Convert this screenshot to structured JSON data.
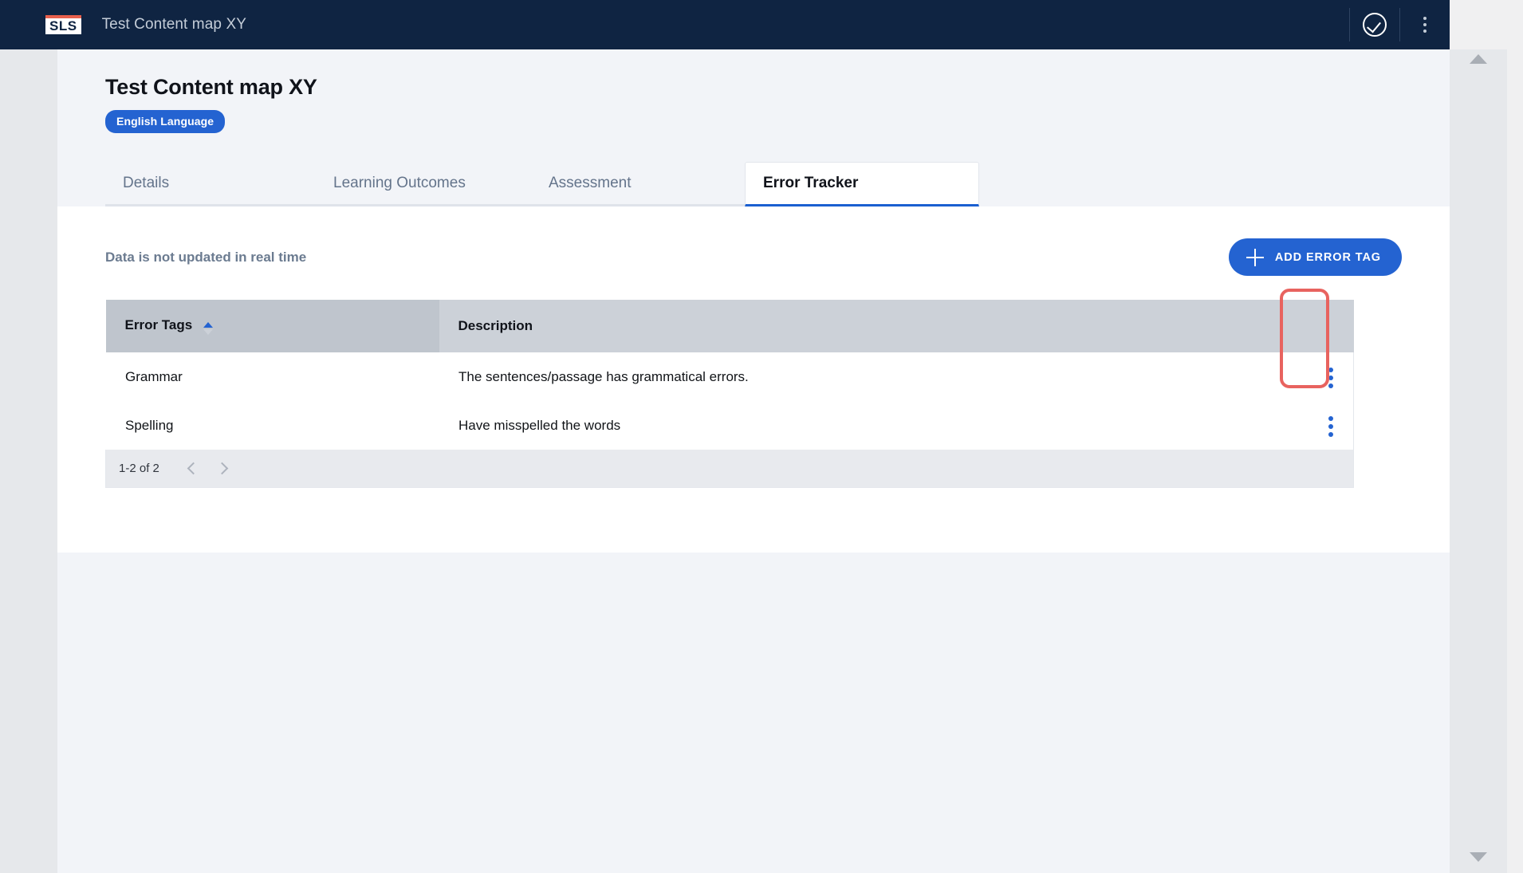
{
  "topbar": {
    "logo_text": "SLS",
    "logo_icon": "sls-logo",
    "title": "Test Content map XY",
    "status_icon": "check-circle-icon",
    "overflow_icon": "kebab-menu-icon"
  },
  "header": {
    "page_title": "Test Content map XY",
    "badge": "English Language"
  },
  "tabs": [
    {
      "label": "Details",
      "active": false
    },
    {
      "label": "Learning Outcomes",
      "active": false
    },
    {
      "label": "Assessment",
      "active": false
    },
    {
      "label": "Error Tracker",
      "active": true
    }
  ],
  "toolbar": {
    "note": "Data is not updated in real time",
    "add_button_label": "ADD ERROR TAG",
    "add_button_icon": "plus-icon"
  },
  "table": {
    "columns": [
      "Error Tags",
      "Description",
      ""
    ],
    "sort": {
      "column": "Error Tags",
      "direction": "asc",
      "icon": "sort-arrows-icon"
    },
    "rows": [
      {
        "error_tag": "Grammar",
        "description": "The sentences/passage has grammatical errors.",
        "row_menu_icon": "kebab-menu-icon"
      },
      {
        "error_tag": "Spelling",
        "description": "Have misspelled the words",
        "row_menu_icon": "kebab-menu-icon"
      }
    ]
  },
  "pagination": {
    "range_label": "1-2 of 2",
    "prev_icon": "chevron-left-icon",
    "next_icon": "chevron-right-icon"
  },
  "scrollbar": {
    "up_icon": "scroll-up-arrow-icon",
    "down_icon": "scroll-down-arrow-icon"
  },
  "colors": {
    "topbar_bg": "#0f2442",
    "accent_blue": "#2463d1",
    "badge_blue": "#2463d1",
    "highlight_red": "#e8635f",
    "logo_accent": "#e8604d",
    "table_header_dark": "#bfc5cd",
    "table_header_light": "#ccd1d8"
  }
}
